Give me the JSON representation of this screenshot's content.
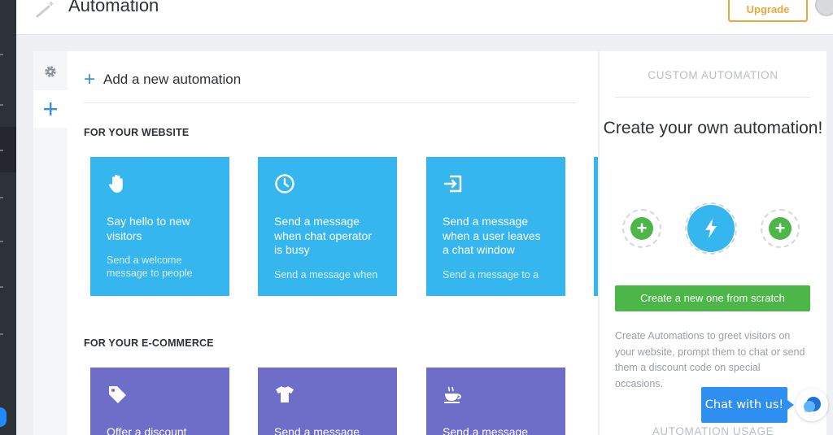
{
  "header": {
    "title": "Automation",
    "upgrade_label": "Upgrade"
  },
  "main": {
    "add_label": "Add a new automation",
    "sections": [
      {
        "title": "FOR YOUR WEBSITE",
        "cards": [
          {
            "icon": "hand-wave-icon",
            "title": "Say hello to new visitors",
            "desc": "Send a welcome message to people"
          },
          {
            "icon": "clock-icon",
            "title": "Send a message when chat operator is busy",
            "desc": "Send a message when"
          },
          {
            "icon": "exit-icon",
            "title": "Send a message when a user leaves a chat window",
            "desc": "Send a message to a"
          }
        ]
      },
      {
        "title": "FOR YOUR E-COMMERCE",
        "cards": [
          {
            "icon": "tag-icon",
            "title": "Offer a discount"
          },
          {
            "icon": "tshirt-icon",
            "title": "Send a message"
          },
          {
            "icon": "coffee-icon",
            "title": "Send a message"
          }
        ]
      }
    ]
  },
  "right_panel": {
    "heading": "CUSTOM AUTOMATION",
    "title": "Create your own automation!",
    "create_button_label": "Create a new one from scratch",
    "description": "Create Automations to greet visitors on your website, prompt them to chat or send them a discount code on special occasions.",
    "heading2": "AUTOMATION USAGE"
  },
  "chat_widget": {
    "label": "Chat with us!"
  },
  "colors": {
    "website_card": "#36b6ee",
    "ecommerce_card": "#6e6dc7",
    "accent_green": "#4cb748",
    "upgrade_orange": "#e7a93a",
    "chat_blue": "#2f8ff0"
  }
}
